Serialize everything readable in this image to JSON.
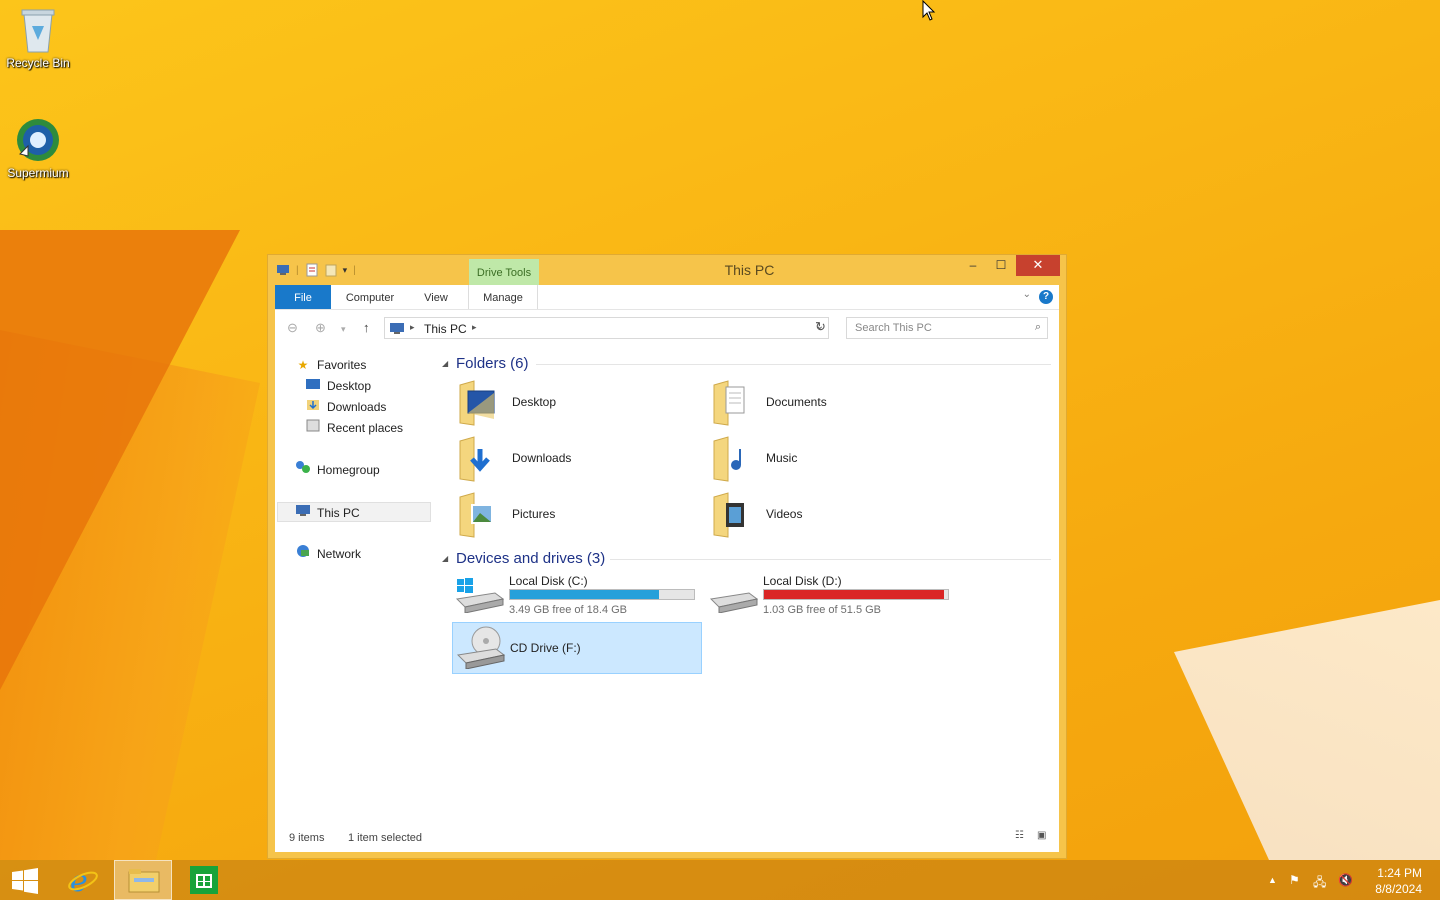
{
  "desktop": {
    "icons": [
      {
        "label": "Recycle Bin",
        "icon": "recycle-bin-icon"
      },
      {
        "label": "Supermium",
        "icon": "supermium-icon"
      }
    ]
  },
  "window": {
    "title": "This PC",
    "context_tab": "Drive Tools",
    "controls": {
      "minimize": "–",
      "maximize": "☐",
      "close": "✕"
    },
    "ribbon_tabs": [
      "File",
      "Computer",
      "View",
      "Manage"
    ],
    "address": {
      "location": "This PC"
    },
    "search": {
      "placeholder": "Search This PC"
    },
    "nav": {
      "favorites": "Favorites",
      "favorites_items": [
        "Desktop",
        "Downloads",
        "Recent places"
      ],
      "homegroup": "Homegroup",
      "this_pc": "This PC",
      "network": "Network"
    },
    "folders_header": "Folders (6)",
    "folders": [
      "Desktop",
      "Documents",
      "Downloads",
      "Music",
      "Pictures",
      "Videos"
    ],
    "drives_header": "Devices and drives (3)",
    "drives": [
      {
        "name": "Local Disk (C:)",
        "free": "3.49 GB free of 18.4 GB",
        "used_fraction": 0.81,
        "bar_color": "#26a0da"
      },
      {
        "name": "Local Disk (D:)",
        "free": "1.03 GB free of 51.5 GB",
        "used_fraction": 0.98,
        "bar_color": "#da2626"
      },
      {
        "name": "CD Drive (F:)"
      }
    ],
    "status": {
      "items": "9 items",
      "selected": "1 item selected"
    }
  },
  "taskbar": {
    "clock_time": "1:24 PM",
    "clock_date": "8/8/2024"
  }
}
